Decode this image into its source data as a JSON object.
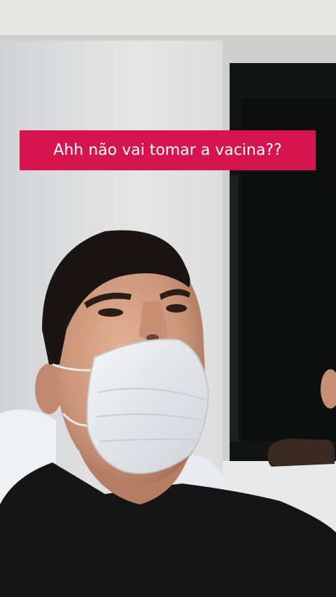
{
  "caption": {
    "text": "Ahh não vai tomar a vacina??"
  },
  "colors": {
    "caption_bg": "#d6154f",
    "caption_text": "#ffffff",
    "wall": "#e3e3e3",
    "shirt": "#151515"
  },
  "icons": []
}
